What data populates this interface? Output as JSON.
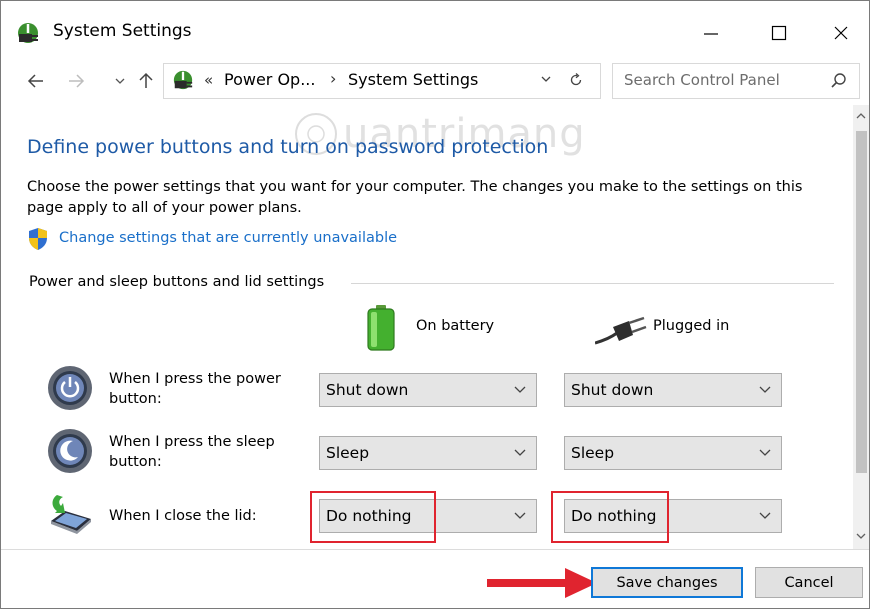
{
  "window": {
    "title": "System Settings",
    "controls": [
      "minimize",
      "maximize",
      "close"
    ]
  },
  "addressbar": {
    "chevron": "«",
    "breadcrumbs": [
      "Power Op...",
      "System Settings"
    ],
    "separator": "›"
  },
  "search": {
    "placeholder": "Search Control Panel"
  },
  "watermark": {
    "text": "uantrimang"
  },
  "content": {
    "title": "Define power buttons and turn on password protection",
    "description": "Choose the power settings that you want for your computer. The changes you make to the settings on this page apply to all of your power plans.",
    "link": "Change settings that are currently unavailable",
    "section_label": "Power and sleep buttons and lid settings",
    "columns": {
      "battery": "On battery",
      "plugged": "Plugged in"
    },
    "rows": [
      {
        "label": "When I press the power button:",
        "icon": "power-button-icon",
        "battery": "Shut down",
        "plugged": "Shut down"
      },
      {
        "label": "When I press the sleep button:",
        "icon": "sleep-button-icon",
        "battery": "Sleep",
        "plugged": "Sleep"
      },
      {
        "label": "When I close the lid:",
        "icon": "laptop-lid-icon",
        "battery": "Do nothing",
        "plugged": "Do nothing"
      }
    ]
  },
  "footer": {
    "save": "Save changes",
    "cancel": "Cancel"
  },
  "colors": {
    "title_blue": "#1e5aa6",
    "link_blue": "#1a6fc9",
    "highlight_red": "#e0242f",
    "focus_blue": "#0f78d7"
  }
}
